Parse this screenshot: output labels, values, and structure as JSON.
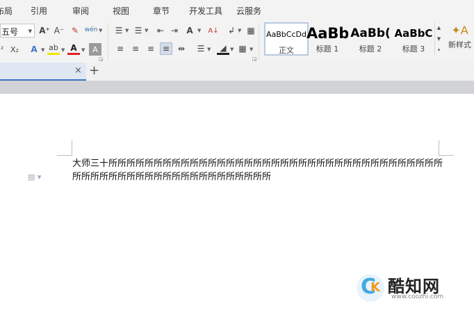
{
  "menu": {
    "tabs": [
      "布局",
      "引用",
      "审阅",
      "视图",
      "章节",
      "开发工具",
      "云服务"
    ]
  },
  "ribbon": {
    "font_size": "五号",
    "styles": [
      {
        "preview": "AaBbCcDd",
        "label": "正文"
      },
      {
        "preview": "AaBb",
        "label": "标题 1"
      },
      {
        "preview": "AaBb(",
        "label": "标题 2"
      },
      {
        "preview": "AaBbC",
        "label": "标题 3"
      }
    ],
    "new_style_label": "新样式",
    "icon_labels": {
      "font_grow": "A⁺",
      "font_shrink": "A⁻",
      "clear_format": "✎",
      "pinyin": "wén",
      "subscript": "X₂",
      "superscript": "²",
      "text_effect": "A",
      "highlight": "ab",
      "font_color": "A",
      "char_shade": "A",
      "bullets": "☰",
      "numbering": "☰",
      "decrease_indent": "⇤",
      "increase_indent": "⇥",
      "chinese_layout": "A",
      "sort": "A↓",
      "show_marks": "↲",
      "table": "▦",
      "align_left": "≡",
      "align_center": "≡",
      "align_right": "≡",
      "justify": "≡",
      "distribute": "⇹",
      "line_spacing": "☰",
      "shading": "◢",
      "borders": "▦"
    }
  },
  "tab_strip": {
    "close": "×",
    "new": "+"
  },
  "document": {
    "text": "大师三十所所所所所所所所所所所所所所所所所所所所所所所所所所所所所所所所所所所所所所所所所所所所所所所所所所所所所所所所所所所"
  },
  "watermark": {
    "brand": "酷知网",
    "url": "www.coozhi.com",
    "logo_letter": "C",
    "logo_k": "K"
  }
}
